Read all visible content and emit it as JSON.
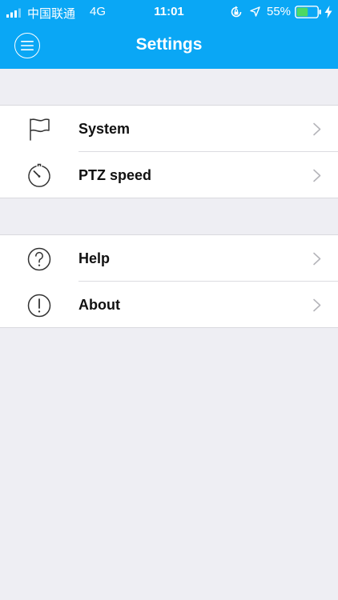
{
  "status_bar": {
    "carrier": "中国联通",
    "network": "4G",
    "time": "11:01",
    "battery_percent": "55%",
    "battery_level": 0.55,
    "icons": [
      "signal-icon",
      "rotation-lock-icon",
      "location-icon",
      "battery-icon",
      "charging-icon"
    ]
  },
  "header": {
    "title": "Settings",
    "menu_icon": "menu-icon"
  },
  "groups": [
    {
      "items": [
        {
          "label": "System",
          "icon": "flag-icon"
        },
        {
          "label": "PTZ speed",
          "icon": "speedometer-icon"
        }
      ]
    },
    {
      "items": [
        {
          "label": "Help",
          "icon": "help-icon"
        },
        {
          "label": "About",
          "icon": "info-icon"
        }
      ]
    }
  ],
  "colors": {
    "accent": "#0aa7f5",
    "background": "#eeeef3",
    "battery_green": "#4cd964"
  }
}
